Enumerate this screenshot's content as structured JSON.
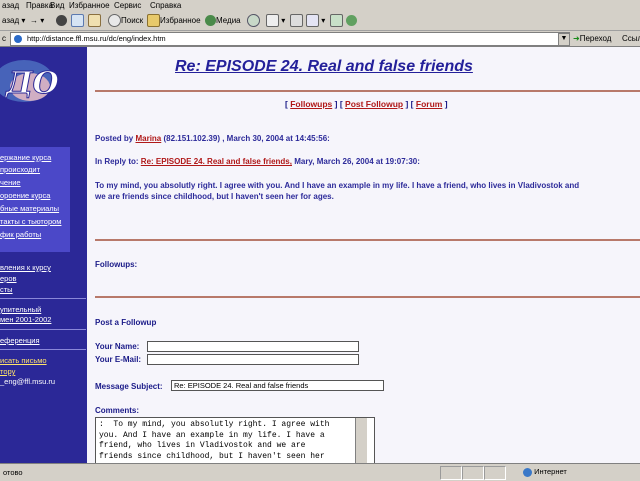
{
  "menu": [
    "азад",
    "Правка",
    "Вид",
    "Избранное",
    "Сервис",
    "Справка"
  ],
  "toolbar": {
    "back": "азад",
    "search": "Поиск",
    "favorites": "Избранное",
    "media": "Медиа"
  },
  "address": {
    "label": "с",
    "url": "http://distance.ffl.msu.ru/dc/eng/index.htm",
    "go": "Переход",
    "links": "Ссылк"
  },
  "sidebar": {
    "logo_text": "ДО",
    "items1": [
      "ержание курса",
      "происходит",
      "чение",
      "ороение курса",
      "бные материалы",
      "такты с тьютором",
      "фик работы"
    ],
    "items2": [
      "вления к курсу",
      "еров",
      "сты"
    ],
    "items3": [
      "упительный",
      "мен 2001-2002"
    ],
    "items4": [
      "еференция"
    ],
    "items5": [
      "исать письмо",
      "тору"
    ],
    "email": "_eng@ffl.msu.ru"
  },
  "post": {
    "title": "Re: EPISODE 24. Real and false friends",
    "nav_open": "[",
    "nav_followups": "Followups",
    "nav_sep1": "] [",
    "nav_post_followup": "Post Followup",
    "nav_sep2": "] [",
    "nav_forum": "Forum",
    "nav_close": "]",
    "posted_by_prefix": "Posted by",
    "author": "Marina",
    "posted_by_suffix": "(82.151.102.39) , March 30, 2004 at 14:45:56:",
    "reply_prefix": "In Reply to:",
    "reply_link": "Re: EPISODE 24. Real and false friends,",
    "reply_suffix": "Mary, March 26, 2004 at 19:07:30:",
    "body_line1": "To my mind, you absolutly right. I agree with you. And I have an example in my life. I have a friend, who lives in Vladivostok and",
    "body_line2": "we are friends since childhood, but I haven't seen her for ages.",
    "followups_label": "Followups:"
  },
  "form": {
    "heading": "Post a Followup",
    "name_label": "Your Name:",
    "email_label": "Your E-Mail:",
    "subject_label": "Message Subject:",
    "subject_value": "Re: EPISODE 24. Real and false friends",
    "comments_label": "Comments:",
    "comments_value": ":  To my mind, you absolutly right. I agree with\nyou. And I have an example in my life. I have a\nfriend, who lives in Vladivostok and we are\nfriends since childhood, but I haven't seen her"
  },
  "status": {
    "left": "отово",
    "right": "Интернет"
  },
  "colors": {
    "sidebar": "#2b2897",
    "title": "#24209a",
    "link": "#b01818",
    "rule": "#b8796a"
  }
}
